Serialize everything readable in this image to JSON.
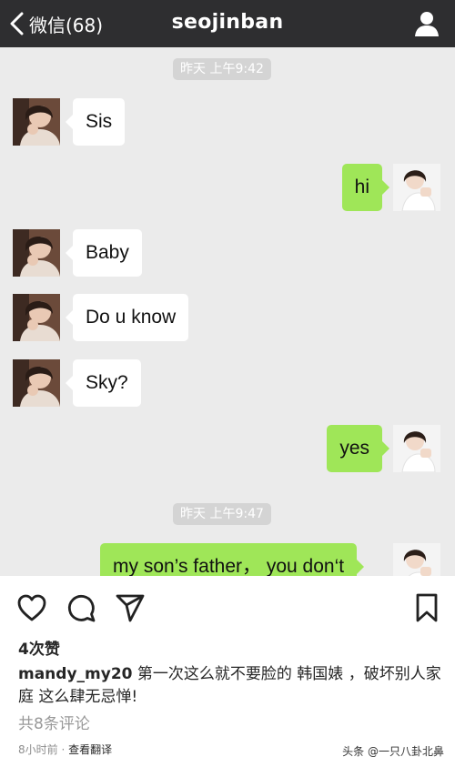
{
  "chat": {
    "back_label": "微信(68)",
    "title": "seojinban",
    "timestamps": [
      "昨天 上午9:42",
      "昨天 上午9:47"
    ],
    "messages": [
      {
        "from": "contact",
        "text": "Sis"
      },
      {
        "from": "self",
        "text": "hi"
      },
      {
        "from": "contact",
        "text": "Baby"
      },
      {
        "from": "contact",
        "text": "Do u know"
      },
      {
        "from": "contact",
        "text": "Sky?"
      },
      {
        "from": "self",
        "text": "yes"
      },
      {
        "from": "self",
        "text": "my son’s father，  you don‘t"
      }
    ],
    "colors": {
      "header": "#2e2e30",
      "background": "#ebebeb",
      "outgoing_bubble": "#9fe658",
      "incoming_bubble": "#ffffff"
    }
  },
  "post": {
    "icons": [
      "heart-icon",
      "comment-icon",
      "send-icon",
      "bookmark-icon"
    ],
    "likes": "4次赞",
    "username": "mandy_my20",
    "caption": " 第一次这么就不要脸的 韩国婊 ，破坏别人家庭 这么肆无忌惮!",
    "comments": "共8条评论",
    "time": "8小时前 · ",
    "translate": "查看翻译",
    "watermark": "头条 @一只八卦北鼻"
  }
}
